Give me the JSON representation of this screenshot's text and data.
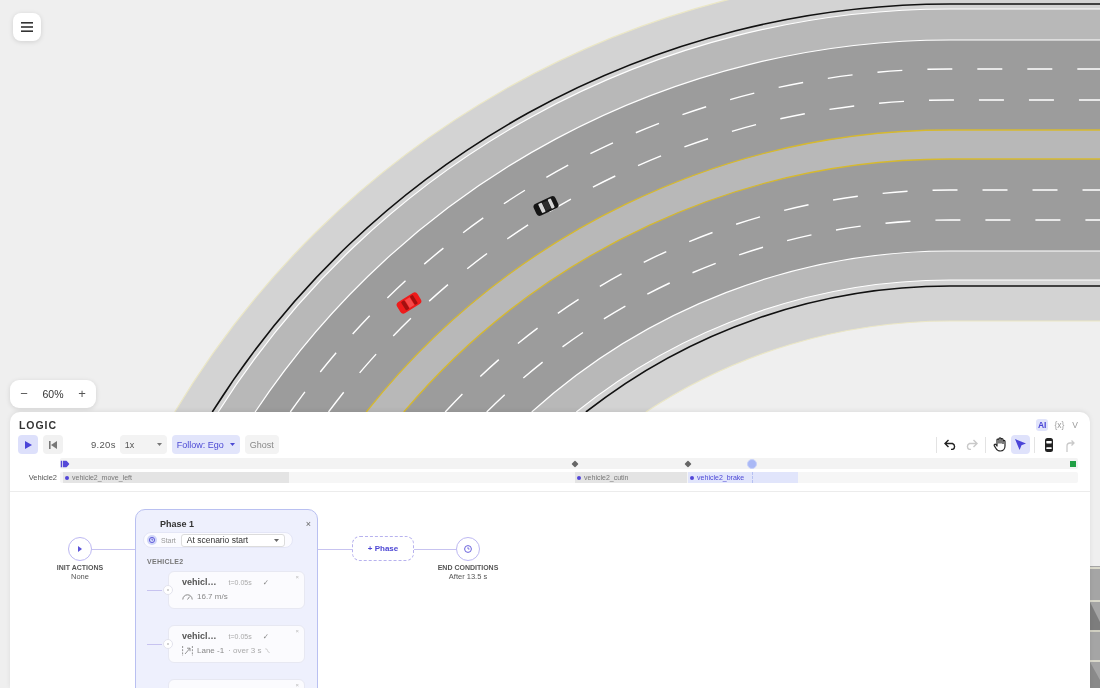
{
  "zoom": {
    "decrease": "−",
    "value": "60%",
    "increase": "+"
  },
  "logic_panel": {
    "title": "LOGIC",
    "toggles": [
      {
        "label": "AI",
        "selected": true
      },
      {
        "label": "{x}",
        "selected": false
      },
      {
        "label": "V",
        "selected": false
      }
    ],
    "playback": {
      "time": "9.20s",
      "speed": "1x",
      "follow": {
        "label": "Follow: Ego",
        "on": true
      },
      "ghost": {
        "label": "Ghost",
        "on": false
      }
    },
    "history": [
      {
        "kind": "undo",
        "disabled": false
      },
      {
        "kind": "redo",
        "disabled": true
      }
    ],
    "modes": [
      {
        "kind": "pan",
        "selected": false
      },
      {
        "kind": "select",
        "selected": true
      }
    ],
    "add_tools": [
      {
        "kind": "vehicle",
        "disabled": false
      },
      {
        "kind": "path",
        "disabled": true
      }
    ],
    "timeline": {
      "level": 0.68,
      "markers": [
        {
          "kind": "start"
        },
        {
          "kind": "event"
        },
        {
          "kind": "event"
        },
        {
          "kind": "end"
        }
      ],
      "tracks": [
        {
          "label": "Vehicle2",
          "clips": [
            {
              "label": "vehicle2_move_left",
              "active": false
            },
            {
              "label": "vehicle2_cutin",
              "active": false
            },
            {
              "label": "vehicle2_brake",
              "active": true
            }
          ]
        }
      ]
    }
  },
  "flow": {
    "init": {
      "title": "INIT ACTIONS",
      "value": "None"
    },
    "phases": [
      {
        "title": "Phase 1",
        "close": "×",
        "start_label": "Start",
        "start_value": "At scenario start",
        "groups": [
          {
            "label": "VEHICLE2",
            "actions": [
              {
                "kind": "speed",
                "title": "vehicl…",
                "time": "t=0.05s",
                "check": "✓",
                "close": "×",
                "value": "16.7 m/s"
              },
              {
                "kind": "lane_change",
                "title": "vehicl…",
                "time": "t=0.05s",
                "check": "✓",
                "close": "×",
                "value": "Lane -1",
                "extra": "· over 3 s"
              },
              {
                "close": "×"
              }
            ]
          }
        ]
      }
    ],
    "add_phase": "+ Phase",
    "end": {
      "title": "END CONDITIONS",
      "value": "After 13.5 s"
    }
  }
}
